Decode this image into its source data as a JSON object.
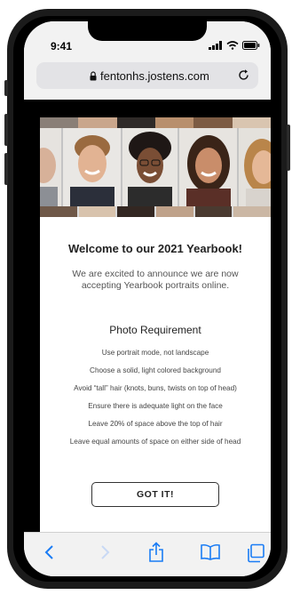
{
  "status_bar": {
    "time": "9:41"
  },
  "browser": {
    "url": "fentonhs.jostens.com"
  },
  "content": {
    "title": "Welcome to our 2021 Yearbook!",
    "intro": "We are excited to announce we are now accepting Yearbook portraits online.",
    "requirements_title": "Photo Requirement",
    "requirements": [
      "Use portrait mode, not landscape",
      "Choose a solid, light colored background",
      "Avoid “tall” hair (knots, buns, twists on top of head)",
      "Ensure there is adequate light on the face",
      "Leave 20% of space above the top of hair",
      "Leave equal amounts of space on either side of head"
    ],
    "button_label": "GOT IT!"
  },
  "colors": {
    "toolbar_icon_active": "#1a7cf5",
    "toolbar_icon_disabled": "#c9d9f5",
    "bezel": "#1b1b1b"
  },
  "icons": [
    "lock-icon",
    "reload-icon",
    "signal-icon",
    "wifi-icon",
    "battery-icon",
    "back-icon",
    "forward-icon",
    "share-icon",
    "bookmarks-icon",
    "tabs-icon"
  ]
}
